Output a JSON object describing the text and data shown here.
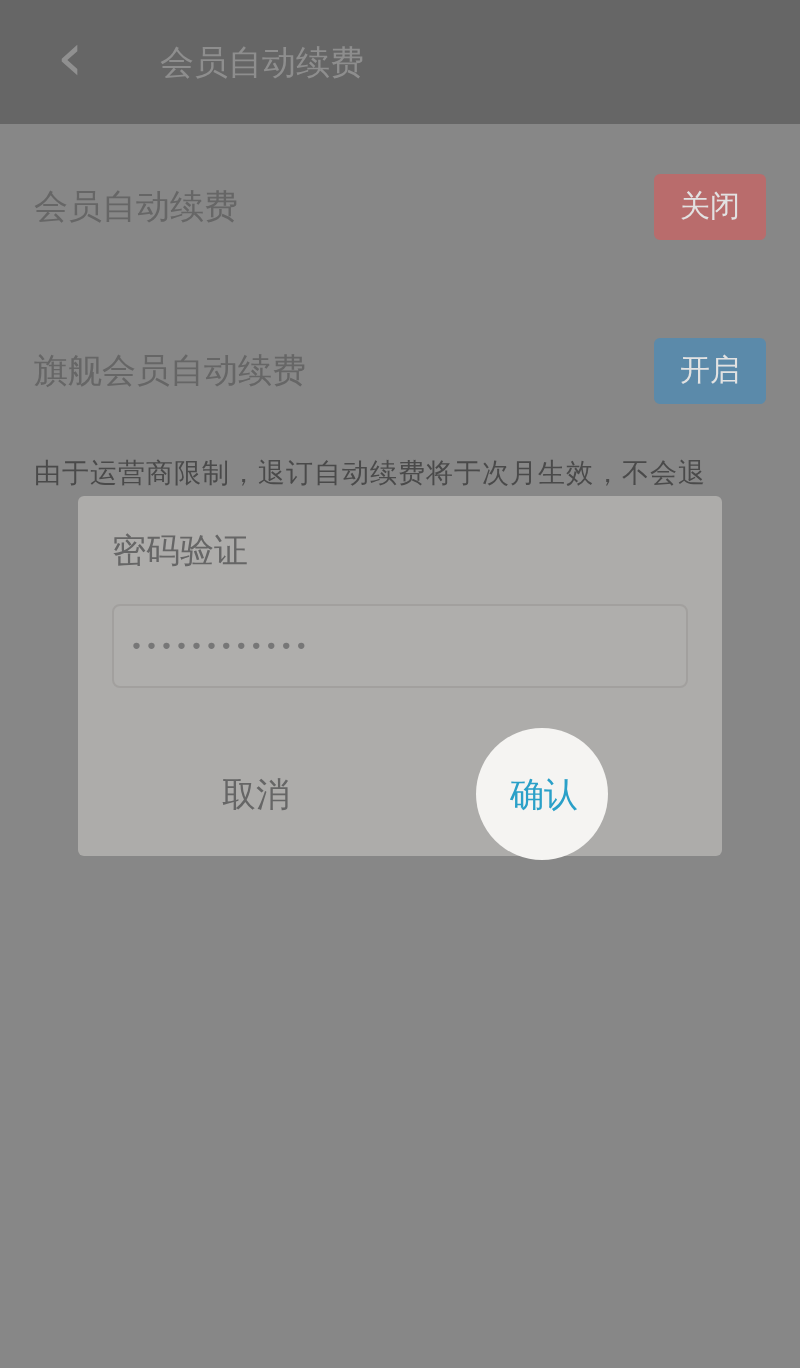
{
  "header": {
    "back_icon": "‹",
    "title": "会员自动续费"
  },
  "settings": [
    {
      "label": "会员自动续费",
      "button": "关闭",
      "color": "#b96c6c"
    },
    {
      "label": "旗舰会员自动续费",
      "button": "开启",
      "color": "#5b8aaa"
    }
  ],
  "note": "由于运营商限制，退订自动续费将于次月生效，不会退",
  "dialog": {
    "title": "密码验证",
    "password": "••••••••••••",
    "buttons": [
      {
        "label": "取消",
        "highlighted": false
      },
      {
        "label": "确认",
        "highlighted": true
      }
    ]
  }
}
